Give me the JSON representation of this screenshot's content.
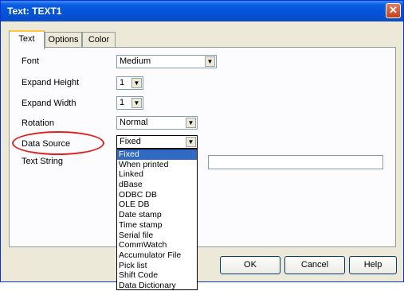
{
  "window": {
    "title": "Text: TEXT1",
    "close_glyph": "✕"
  },
  "tabs": [
    {
      "label": "Text",
      "active": true
    },
    {
      "label": "Options",
      "active": false
    },
    {
      "label": "Color",
      "active": false
    }
  ],
  "fields": {
    "font": {
      "label": "Font",
      "value": "Medium"
    },
    "expand_height": {
      "label": "Expand Height",
      "value": "1"
    },
    "expand_width": {
      "label": "Expand Width",
      "value": "1"
    },
    "rotation": {
      "label": "Rotation",
      "value": "Normal"
    },
    "data_source": {
      "label": "Data Source",
      "value": "Fixed"
    },
    "text_string": {
      "label": "Text String",
      "value": ""
    }
  },
  "data_source_options": [
    "Fixed",
    "When printed",
    "Linked",
    "dBase",
    "ODBC DB",
    "OLE DB",
    "Date stamp",
    "Time stamp",
    "Serial file",
    "CommWatch",
    "Accumulator File",
    "Pick list",
    "Shift Code",
    "Data Dictionary"
  ],
  "selected_option": "Fixed",
  "buttons": {
    "ok": "OK",
    "cancel": "Cancel",
    "help": "Help"
  },
  "annotation": {
    "color": "#e02020",
    "shape": "ellipse around Data Source label"
  },
  "colors": {
    "titlebar": "#0553d6",
    "selection": "#316ac5",
    "dialog_bg": "#ece9d8"
  }
}
